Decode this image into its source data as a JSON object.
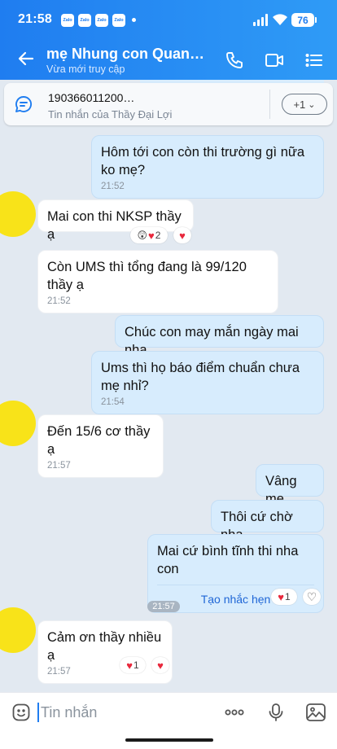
{
  "status_bar": {
    "time": "21:58",
    "app_icon_label": "Zalo",
    "battery": "76"
  },
  "header": {
    "title": "mẹ Nhung con Quang Hu…",
    "subtitle": "Vừa mới truy cập"
  },
  "pinned": {
    "title": "190366011200…",
    "subtitle": "Tin nhắn của Thầy Đại Lợi",
    "more_count": "+1"
  },
  "messages": [
    {
      "text": "Hôm tới con còn thi trường gì nữa ko mẹ?",
      "time": "21:52"
    },
    {
      "text": "Mai con thi NKSP thầy ạ",
      "reaction_count": "2"
    },
    {
      "text": "Còn UMS thì tổng đang là 99/120 thầy ạ",
      "time": "21:52"
    },
    {
      "text": "Chúc con may mắn ngày mai nha"
    },
    {
      "text": "Ums thì họ báo điểm chuẩn chưa mẹ nhỉ?",
      "time": "21:54"
    },
    {
      "text": "Đến 15/6 cơ thầy ạ",
      "time": "21:57"
    },
    {
      "text": "Vâng mẹ"
    },
    {
      "text": "Thôi cứ chờ nha."
    },
    {
      "text": "Mai cứ bình tĩnh thi nha con",
      "action": "Tạo nhắc hẹn",
      "reaction_count": "1"
    },
    {
      "text": "Cảm ơn thầy nhiều ạ",
      "time": "21:57",
      "reaction_count": "1"
    }
  ],
  "time_divider": "21:57",
  "input": {
    "placeholder": "Tin nhắn"
  },
  "icons": [
    "back-arrow-icon",
    "phone-icon",
    "video-call-icon",
    "menu-list-icon",
    "message-icon",
    "emoji-icon",
    "more-icon",
    "microphone-icon",
    "image-icon",
    "heart-icon",
    "surprised-face-icon"
  ],
  "colors": {
    "header": "#1f7df0",
    "background": "#e2e9f1",
    "sent_bubble": "#d7ecfd",
    "received_bubble": "#ffffff",
    "avatar": "#f8e319",
    "heart": "#e8283c"
  }
}
